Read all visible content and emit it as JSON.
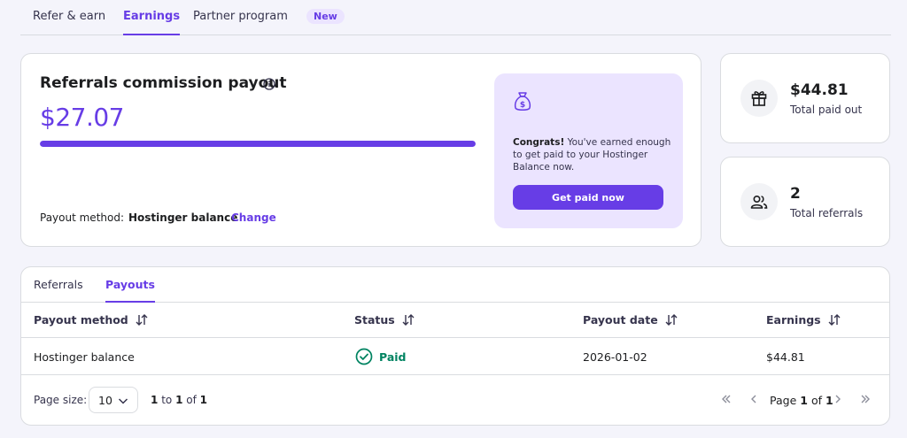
{
  "top_tabs": [
    {
      "label": "Refer & earn",
      "active": false
    },
    {
      "label": "Earnings",
      "active": true
    },
    {
      "label": "Partner program",
      "active": false
    }
  ],
  "new_badge": "New",
  "commission": {
    "title": "Referrals commission payout",
    "amount": "$27.07",
    "progress_percent": 100,
    "payout_method_label": "Payout method:",
    "payout_method_value": "Hostinger balance",
    "change_label": "Change"
  },
  "congrats": {
    "bold": "Congrats!",
    "text": " You've earned enough to get paid to your Hostinger Balance now.",
    "button_label": "Get paid now"
  },
  "stats": [
    {
      "value": "$44.81",
      "label": "Total paid out",
      "icon": "gift-icon"
    },
    {
      "value": "2",
      "label": "Total referrals",
      "icon": "users-icon"
    }
  ],
  "table_tabs": [
    {
      "label": "Referrals",
      "active": false
    },
    {
      "label": "Payouts",
      "active": true
    }
  ],
  "columns": [
    "Payout method",
    "Status",
    "Payout date",
    "Earnings"
  ],
  "rows": [
    {
      "payout_method": "Hostinger balance",
      "status": "Paid",
      "payout_date": "2026-01-02",
      "earnings": "$44.81"
    }
  ],
  "pagination": {
    "page_size_label": "Page size:",
    "page_size": "10",
    "range_from": "1",
    "range_to_word": "to",
    "range_to": "1",
    "of_word": "of",
    "total": "1",
    "page_word": "Page",
    "current_page": "1",
    "total_pages": "1"
  },
  "colors": {
    "accent": "#673de6",
    "accent_light": "#ebe4ff",
    "success": "#008361",
    "background": "#f4f4fb"
  }
}
